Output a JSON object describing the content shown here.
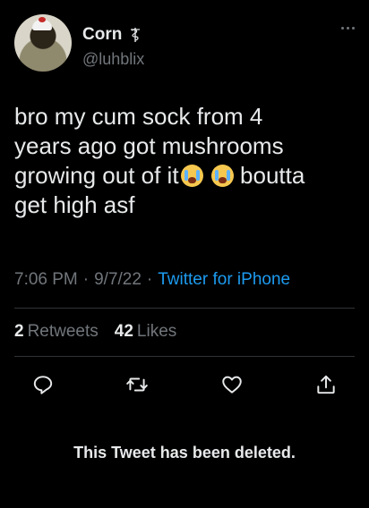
{
  "author": {
    "display_name": "Corn",
    "handle": "@luhblix"
  },
  "tweet": {
    "lines": [
      "bro my cum sock from 4",
      "years ago got mushrooms",
      "growing out of it",
      "get high asf"
    ],
    "line3_suffix": "boutta",
    "emoji_name": "loudly-crying-face"
  },
  "meta": {
    "time": "7:06 PM",
    "separator1": "·",
    "date": "9/7/22",
    "separator2": "·",
    "source": "Twitter for iPhone"
  },
  "stats": {
    "retweets_count": "2",
    "retweets_label": "Retweets",
    "likes_count": "42",
    "likes_label": "Likes"
  },
  "actions": [
    "reply-icon",
    "retweet-icon",
    "like-icon",
    "share-icon"
  ],
  "notice": "This Tweet has been deleted.",
  "colors": {
    "background": "#000000",
    "text": "#e7e9ea",
    "muted": "#71767b",
    "link": "#1d9bf0",
    "divider": "#2f3336"
  }
}
